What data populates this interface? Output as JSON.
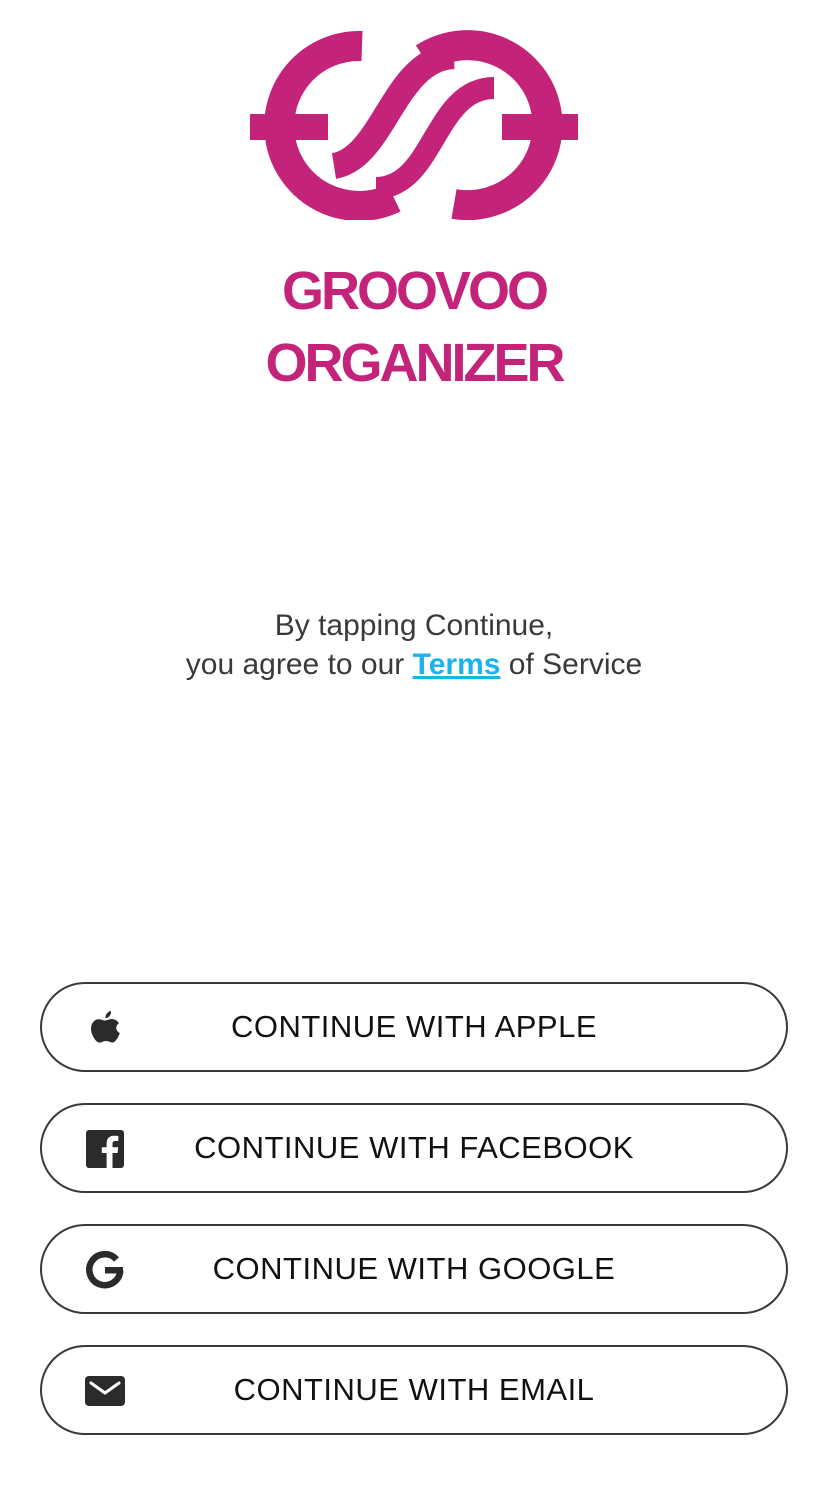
{
  "brand": {
    "line1": "GROOVOO",
    "line2": "ORGANIZER",
    "color": "#c4237a",
    "logo_icon": "groovoo-infinity-logo"
  },
  "terms": {
    "line1": "By tapping Continue,",
    "line2_prefix": "you agree to our ",
    "link_label": "Terms",
    "line2_suffix": " of Service",
    "link_color": "#1ab3ec"
  },
  "buttons": [
    {
      "label": "CONTINUE WITH APPLE",
      "icon": "apple-icon"
    },
    {
      "label": "CONTINUE WITH FACEBOOK",
      "icon": "facebook-icon"
    },
    {
      "label": "CONTINUE WITH GOOGLE",
      "icon": "google-icon"
    },
    {
      "label": "CONTINUE WITH EMAIL",
      "icon": "mail-icon"
    }
  ]
}
